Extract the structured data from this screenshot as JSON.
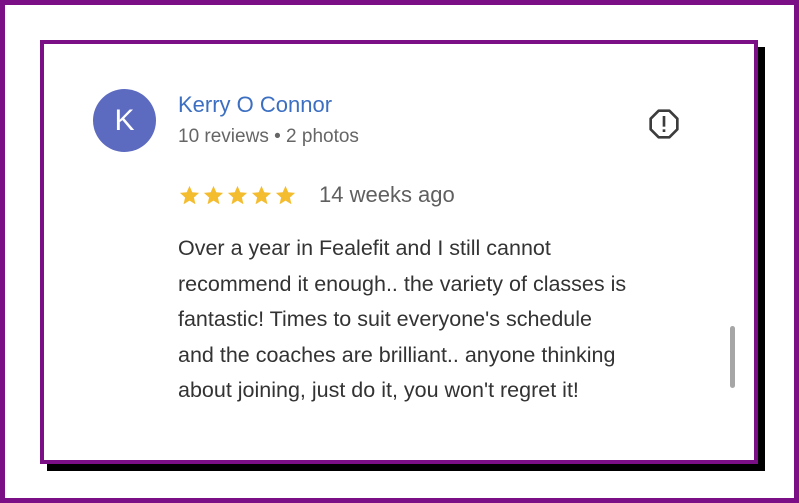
{
  "review": {
    "avatar_letter": "K",
    "avatar_color": "#5c6bc0",
    "reviewer_name": "Kerry O Connor",
    "reviewer_meta": "10 reviews • 2 photos",
    "rating": 5,
    "rating_max": 5,
    "time_ago": "14 weeks ago",
    "text_lines": [
      "Over a year in Fealefit and I still cannot",
      "recommend it enough.. the variety of classes is",
      "fantastic! Times to suit everyone's schedule",
      "and the coaches are brilliant.. anyone thinking",
      "about joining, just do it, you won't regret it!"
    ],
    "report_icon": "report-flag-icon"
  },
  "colors": {
    "frame": "#7b0f86",
    "name_link": "#3c6fc2",
    "star": "#f4bc2f"
  }
}
